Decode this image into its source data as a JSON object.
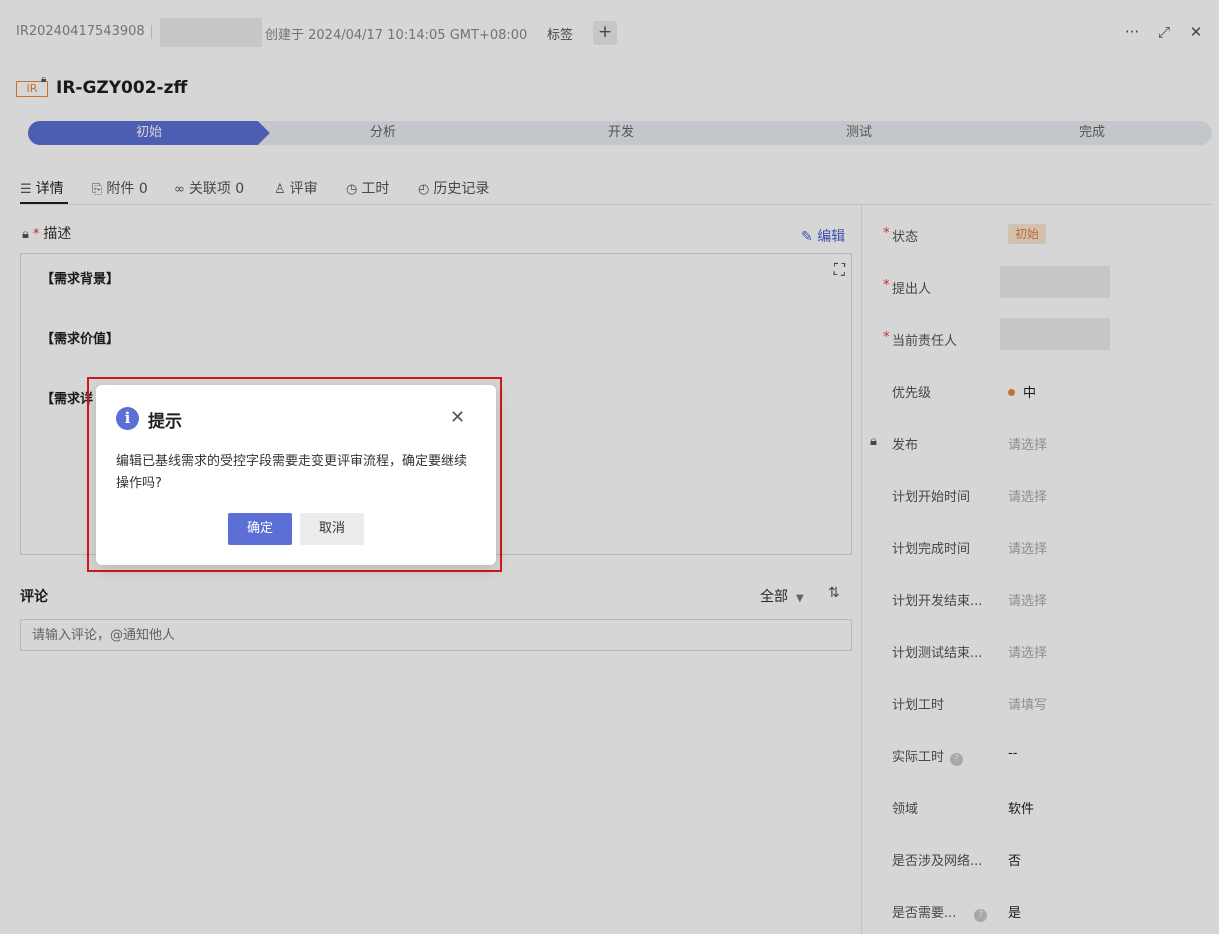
{
  "header": {
    "id": "IR20240417543908",
    "created": "创建于 2024/04/17 10:14:05 GMT+08:00",
    "tag_label": "标签",
    "add_tag": "+",
    "more": "···",
    "expand": "⤢",
    "close": "✕"
  },
  "item": {
    "type_badge": "IR",
    "title": "IR-GZY002-zff"
  },
  "workflow": {
    "steps": [
      "初始",
      "分析",
      "开发",
      "测试",
      "完成"
    ],
    "active": "初始"
  },
  "tabs": [
    {
      "label": "详情",
      "icon": "document-icon"
    },
    {
      "label": "附件 0",
      "icon": "paperclip-icon"
    },
    {
      "label": "关联项 0",
      "icon": "link-icon"
    },
    {
      "label": "评审",
      "icon": "stamp-icon"
    },
    {
      "label": "工时",
      "icon": "clock-icon"
    },
    {
      "label": "历史记录",
      "icon": "history-icon"
    }
  ],
  "description": {
    "label": "描述",
    "edit": "编辑",
    "lines": [
      "【需求背景】",
      "【需求价值】",
      "【需求详"
    ]
  },
  "comments": {
    "label": "评论",
    "filter": "全部",
    "placeholder": "请输入评论，@通知他人"
  },
  "fields": [
    {
      "label": "状态",
      "required": true,
      "value": "初始",
      "kind": "badge"
    },
    {
      "label": "提出人",
      "required": true,
      "value": "",
      "kind": "blurred"
    },
    {
      "label": "当前责任人",
      "required": true,
      "value": "",
      "kind": "blurred"
    },
    {
      "label": "优先级",
      "value": "中",
      "kind": "priority"
    },
    {
      "label": "发布",
      "value": "请选择",
      "kind": "placeholder",
      "locked": true
    },
    {
      "label": "计划开始时间",
      "value": "请选择",
      "kind": "placeholder"
    },
    {
      "label": "计划完成时间",
      "value": "请选择",
      "kind": "placeholder"
    },
    {
      "label": "计划开发结束...",
      "value": "请选择",
      "kind": "placeholder"
    },
    {
      "label": "计划测试结束...",
      "value": "请选择",
      "kind": "placeholder"
    },
    {
      "label": "计划工时",
      "value": "请填写",
      "kind": "placeholder"
    },
    {
      "label": "实际工时",
      "value": "--",
      "kind": "text",
      "help": true
    },
    {
      "label": "领域",
      "value": "软件",
      "kind": "text"
    },
    {
      "label": "是否涉及网络...",
      "value": "否",
      "kind": "text"
    },
    {
      "label": "是否需要...",
      "value": "是",
      "kind": "text",
      "help": true
    }
  ],
  "dialog": {
    "title": "提示",
    "message": "编辑已基线需求的受控字段需要走变更评审流程，确定要继续操作吗?",
    "ok": "确定",
    "cancel": "取消"
  },
  "colors": {
    "accent": "#5b6fd6",
    "warning": "#e8893a",
    "highlight_border": "#d0181c"
  }
}
